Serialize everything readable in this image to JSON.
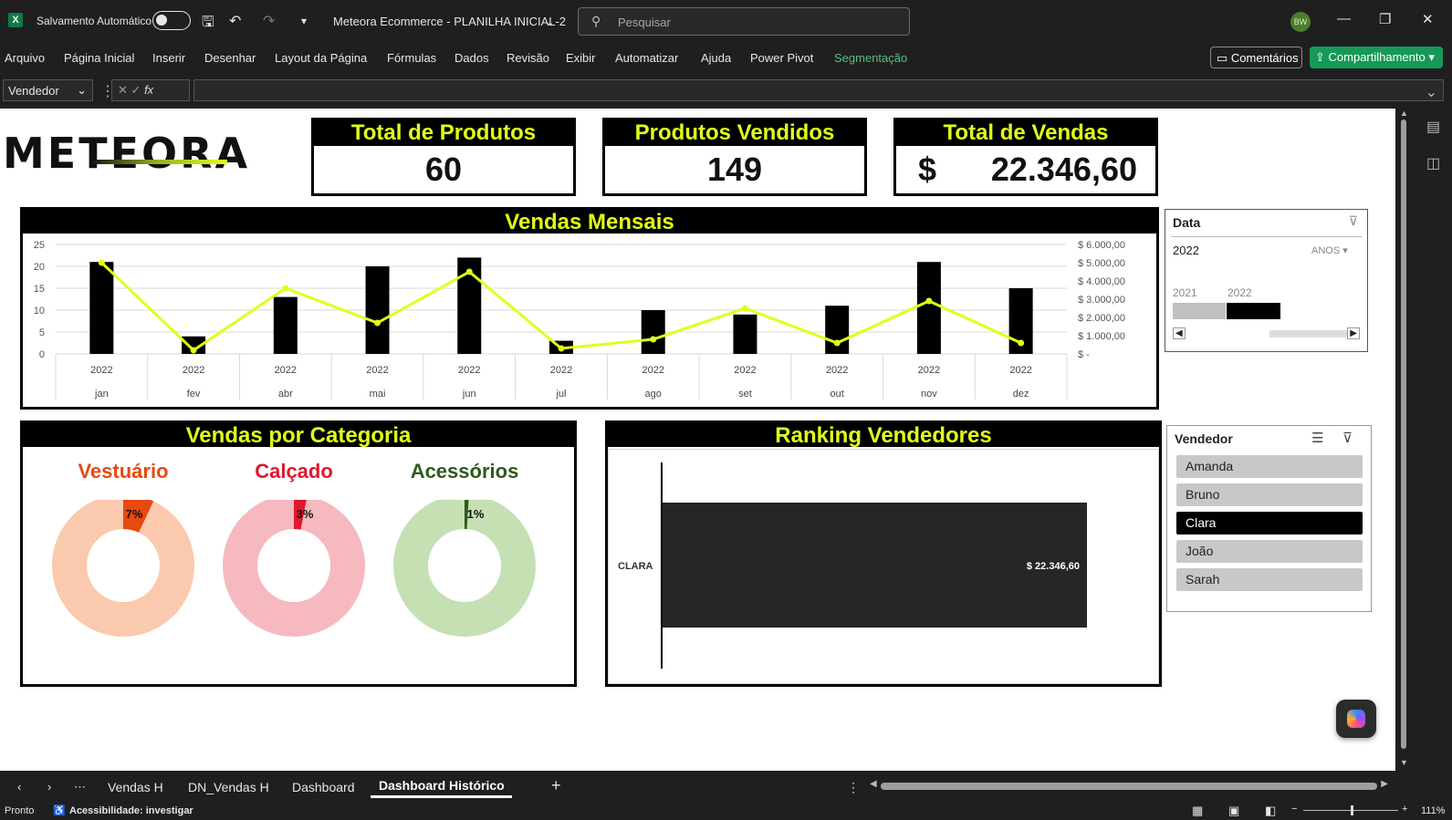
{
  "titlebar": {
    "autosave_label": "Salvamento Automático",
    "doc_title": "Meteora Ecommerce - PLANILHA INICIAL-2",
    "search_placeholder": "Pesquisar",
    "user_initials": "BW"
  },
  "menu": [
    "Arquivo",
    "Página Inicial",
    "Inserir",
    "Desenhar",
    "Layout da Página",
    "Fórmulas",
    "Dados",
    "Revisão",
    "Exibir",
    "Automatizar",
    "Ajuda",
    "Power Pivot",
    "Segmentação"
  ],
  "menu_active": "Segmentação",
  "ribbon_buttons": {
    "comments": "Comentários",
    "share": "Compartilhamento"
  },
  "formula_bar": {
    "namebox": "Vendedor",
    "fx": "fx"
  },
  "dashboard": {
    "logo": "METEORA",
    "kpis": [
      {
        "title": "Total de Produtos",
        "value": "60"
      },
      {
        "title": "Produtos Vendidos",
        "value": "149"
      },
      {
        "title": "Total de Vendas",
        "currency": "$",
        "value": "22.346,60"
      }
    ],
    "monthly_title": "Vendas Mensais",
    "category_title": "Vendas por Categoria",
    "ranking_title": "Ranking Vendedores",
    "categories": [
      {
        "name": "Vestuário",
        "pct_label": "7%",
        "color": "#e8490f",
        "light": "#fbc9ad"
      },
      {
        "name": "Calçado",
        "pct_label": "3%",
        "color": "#e0182d",
        "light": "#f5b9bf"
      },
      {
        "name": "Acessórios",
        "pct_label": "1%",
        "color": "#2f5a1d",
        "light": "#c5e0b3"
      }
    ]
  },
  "chart_data": [
    {
      "type": "bar",
      "title": "Vendas Mensais",
      "categories": [
        "jan",
        "fev",
        "abr",
        "mai",
        "jun",
        "jul",
        "ago",
        "set",
        "out",
        "nov",
        "dez"
      ],
      "category_year": "2022",
      "series": [
        {
          "values": [
            21,
            4,
            13,
            20,
            22,
            3,
            10,
            9,
            11,
            21,
            15
          ],
          "axis": "left",
          "kind": "bar",
          "color": "#000000"
        },
        {
          "values": [
            5000,
            200,
            3600,
            1700,
            4500,
            300,
            800,
            2500,
            600,
            2900,
            600
          ],
          "axis": "right",
          "kind": "line",
          "color": "#e1ff19"
        }
      ],
      "ylim": [
        0,
        25
      ],
      "yticks": [
        "25",
        "20",
        "15",
        "10",
        "5",
        "0"
      ],
      "y2lim": [
        0,
        6000
      ],
      "y2ticks": [
        "$ 6.000,00",
        "$ 5.000,00",
        "$ 4.000,00",
        "$ 3.000,00",
        "$ 2.000,00",
        "$ 1.000,00",
        "$ -"
      ],
      "grid": true
    },
    {
      "type": "bar",
      "title": "Ranking Vendedores",
      "orientation": "horizontal",
      "categories": [
        "CLARA"
      ],
      "values": [
        22346.6
      ],
      "value_labels": [
        "$ 22.346,60"
      ]
    }
  ],
  "slicer_data": {
    "title": "Data",
    "selected": "2022",
    "level": "ANOS",
    "years": [
      "2021",
      "2022"
    ]
  },
  "slicer_vendedor": {
    "title": "Vendedor",
    "items": [
      "Amanda",
      "Bruno",
      "Clara",
      "João",
      "Sarah"
    ],
    "selected": "Clara"
  },
  "sheet_tabs": [
    "Vendas H",
    "DN_Vendas H",
    "Dashboard",
    "Dashboard Histórico"
  ],
  "active_tab": "Dashboard Histórico",
  "status": {
    "ready": "Pronto",
    "accessibility": "Acessibilidade: investigar",
    "zoom": "111%"
  }
}
